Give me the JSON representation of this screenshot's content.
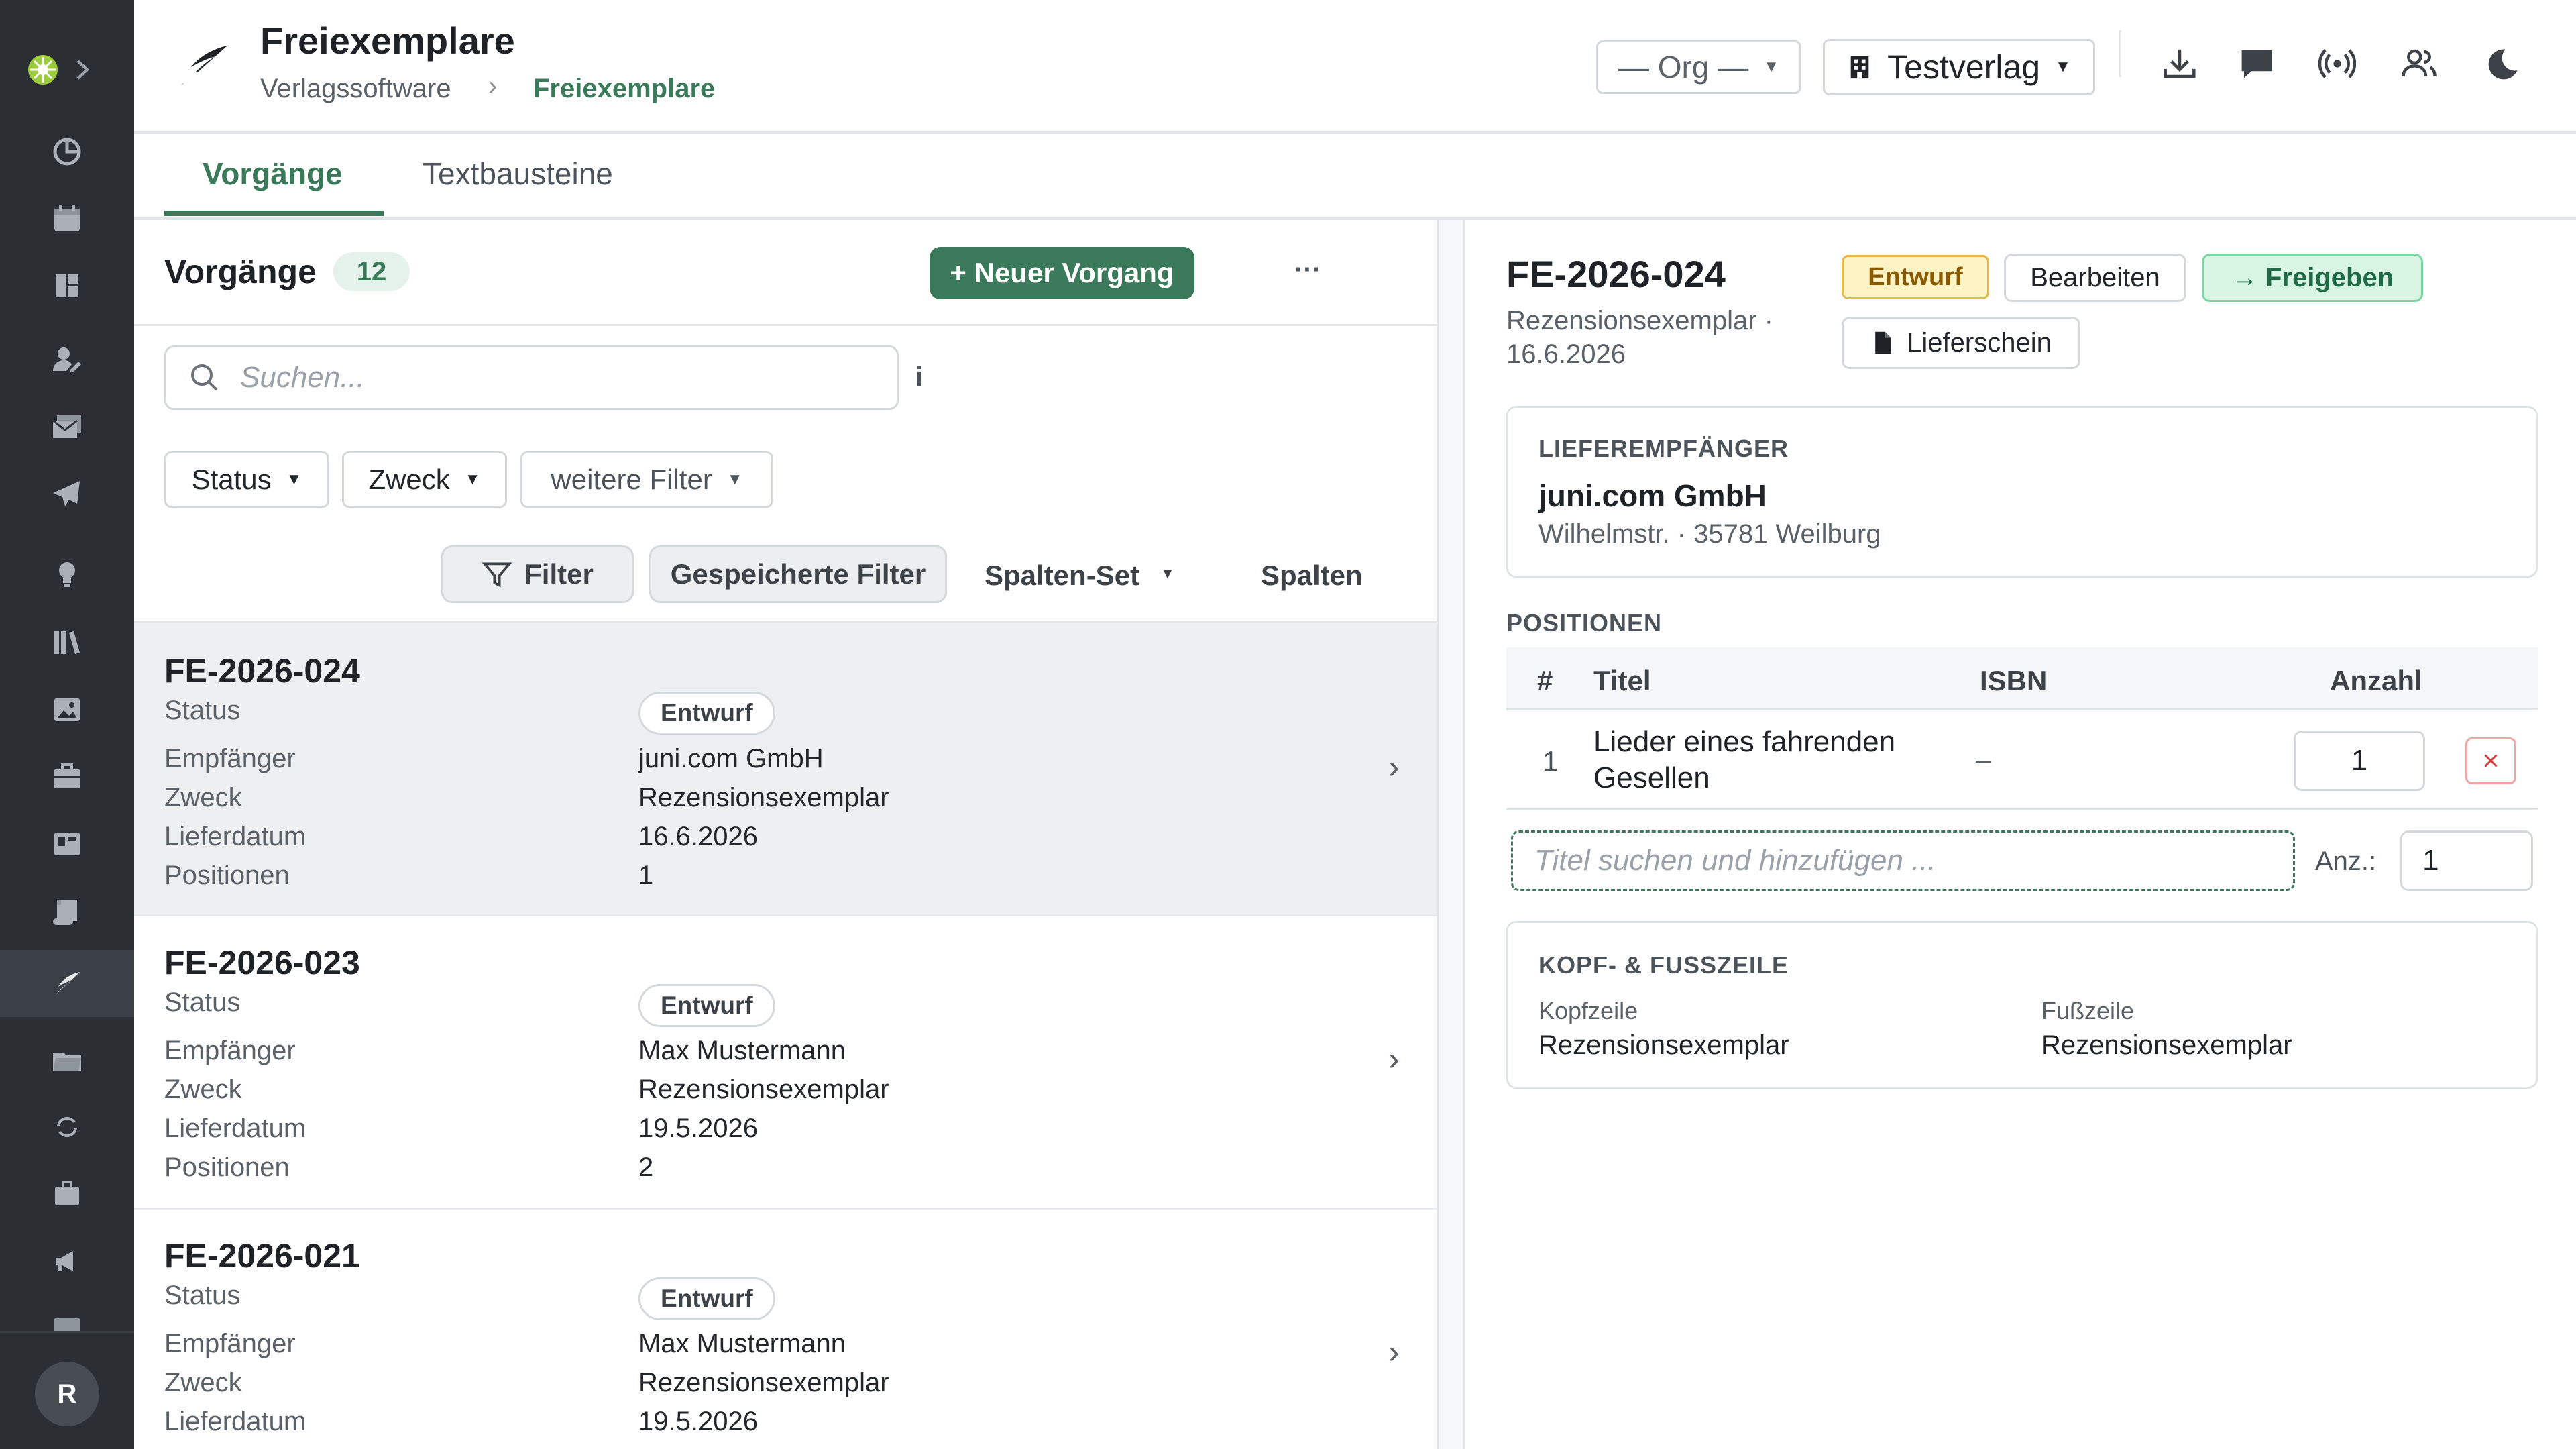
{
  "app": {
    "title": "Freiexemplare",
    "avatar_initial": "R"
  },
  "breadcrumb": {
    "root": "Verlagssoftware",
    "current": "Freiexemplare"
  },
  "header": {
    "org_select": "— Org —",
    "publisher_select": "Testverlag"
  },
  "tabs": [
    {
      "label": "Vorgänge",
      "active": true
    },
    {
      "label": "Textbausteine",
      "active": false
    }
  ],
  "list": {
    "title": "Vorgänge",
    "count": "12",
    "new_button": "+ Neuer Vorgang",
    "more": "···",
    "search_placeholder": "Suchen...",
    "info": "i",
    "filters": [
      "Status",
      "Zweck",
      "weitere Filter"
    ],
    "toolbar": {
      "filter": "Filter",
      "saved": "Gespeicherte Filter",
      "column_set": "Spalten-Set",
      "columns": "Spalten"
    },
    "labels": {
      "status": "Status",
      "recipient": "Empfänger",
      "purpose": "Zweck",
      "delivery": "Lieferdatum",
      "positions": "Positionen"
    },
    "items": [
      {
        "id": "FE-2026-024",
        "status": "Entwurf",
        "recipient": "juni.com GmbH",
        "purpose": "Rezensionsexemplar",
        "delivery": "16.6.2026",
        "positions": "1"
      },
      {
        "id": "FE-2026-023",
        "status": "Entwurf",
        "recipient": "Max Mustermann",
        "purpose": "Rezensionsexemplar",
        "delivery": "19.5.2026",
        "positions": "2"
      },
      {
        "id": "FE-2026-021",
        "status": "Entwurf",
        "recipient": "Max Mustermann",
        "purpose": "Rezensionsexemplar",
        "delivery": "19.5.2026",
        "positions": ""
      }
    ]
  },
  "detail": {
    "id": "FE-2026-024",
    "subtitle_line1": "Rezensionsexemplar ·",
    "subtitle_line2": "16.6.2026",
    "status_badge": "Entwurf",
    "edit_button": "Bearbeiten",
    "release_button": "→ Freigeben",
    "delivery_note_button": "Lieferschein",
    "recipient_section": "LIEFEREMPFÄNGER",
    "recipient_name": "juni.com GmbH",
    "recipient_address": "Wilhelmstr. · 35781 Weilburg",
    "positions_section": "POSITIONEN",
    "table_headers": {
      "num": "#",
      "title": "Titel",
      "isbn": "ISBN",
      "qty": "Anzahl"
    },
    "rows": [
      {
        "num": "1",
        "title_line1": "Lieder eines fahrenden",
        "title_line2": "Gesellen",
        "isbn": "–",
        "qty": "1"
      }
    ],
    "add_placeholder": "Titel suchen und hinzufügen ...",
    "qty_label": "Anz.:",
    "qty_value": "1",
    "header_footer_section": "KOPF- & FUSSZEILE",
    "header_label": "Kopfzeile",
    "header_value": "Rezensionsexemplar",
    "footer_label": "Fußzeile",
    "footer_value": "Rezensionsexemplar"
  },
  "colors": {
    "accent": "#3a7a5a",
    "sidebar": "#2b2f33",
    "draft_bg": "#fdf3c4",
    "draft_border": "#e5b94a",
    "release_bg": "#d8f5e3"
  },
  "sidebar_icons": [
    "logo-icon",
    "chevron-right-icon",
    "chart-icon",
    "calendar-icon",
    "dashboard-icon",
    "user-edit-icon",
    "mail-icon",
    "send-icon",
    "lightbulb-icon",
    "library-icon",
    "image-icon",
    "briefcase-icon",
    "board-icon",
    "scroll-icon",
    "feather-icon",
    "folder-icon",
    "sync-icon",
    "suitcase-icon",
    "megaphone-icon"
  ]
}
